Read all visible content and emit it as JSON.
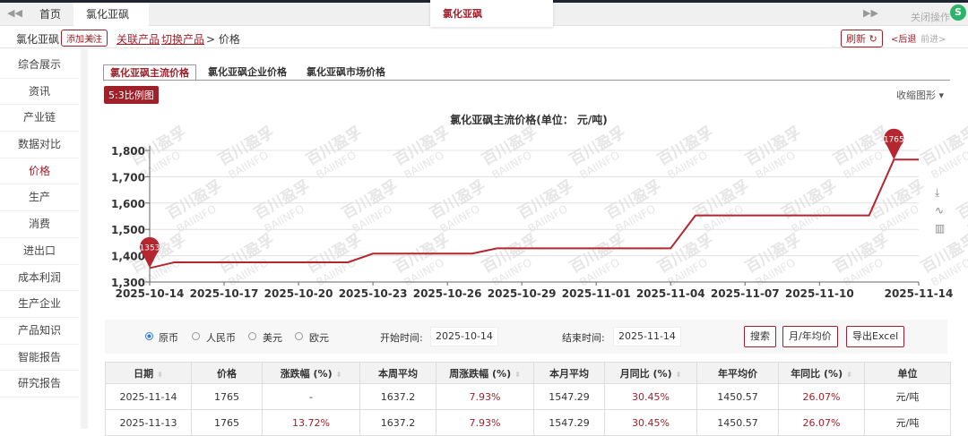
{
  "tabs": {
    "home": "首页",
    "current": "氯化亚砜",
    "popup": "氯化亚砜",
    "close_ops": "关闭操作"
  },
  "breadcrumb": {
    "product": "氯化亚砜",
    "follow": "添加关注",
    "related": "关联产品",
    "switch": "切换产品",
    "current": "> 价格",
    "refresh": "刷新 ↻",
    "back": "<后退",
    "forward": "前进>"
  },
  "sidebar": {
    "items": [
      "综合展示",
      "资讯",
      "产业链",
      "数据对比",
      "价格",
      "生产",
      "消费",
      "进出口",
      "成本利润",
      "生产企业",
      "产品知识",
      "智能报告",
      "研究报告"
    ],
    "active": 4
  },
  "content_tabs": [
    "氯化亚砜主流价格",
    "氯化亚砜企业价格",
    "氯化亚砜市场价格"
  ],
  "ratio_label": "5:3比例图",
  "collapse_label": "收缩图形 ▾",
  "chart_data": {
    "type": "line",
    "title": "氯化亚砜主流价格(单位： 元/吨)",
    "x": [
      "2025-10-14",
      "2025-10-15",
      "2025-10-16",
      "2025-10-17",
      "2025-10-18",
      "2025-10-19",
      "2025-10-20",
      "2025-10-21",
      "2025-10-22",
      "2025-10-23",
      "2025-10-24",
      "2025-10-25",
      "2025-10-26",
      "2025-10-27",
      "2025-10-28",
      "2025-10-29",
      "2025-10-30",
      "2025-10-31",
      "2025-11-01",
      "2025-11-02",
      "2025-11-03",
      "2025-11-04",
      "2025-11-05",
      "2025-11-06",
      "2025-11-07",
      "2025-11-08",
      "2025-11-09",
      "2025-11-10",
      "2025-11-11",
      "2025-11-12",
      "2025-11-13",
      "2025-11-14"
    ],
    "values": [
      1353,
      1375,
      1375,
      1375,
      1375,
      1375,
      1375,
      1375,
      1375,
      1408,
      1408,
      1408,
      1408,
      1408,
      1428,
      1428,
      1428,
      1428,
      1428,
      1428,
      1428,
      1428,
      1553,
      1553,
      1553,
      1553,
      1553,
      1553,
      1553,
      1553,
      1765,
      1765
    ],
    "xticks": [
      "2025-10-14",
      "2025-10-17",
      "2025-10-20",
      "2025-10-23",
      "2025-10-26",
      "2025-10-29",
      "2025-11-01",
      "2025-11-04",
      "2025-11-07",
      "2025-11-10",
      "2025-11-14"
    ],
    "yticks": [
      "1,300",
      "1,400",
      "1,500",
      "1,600",
      "1,700",
      "1,800"
    ],
    "ylim": [
      1300,
      1800
    ],
    "markers": [
      {
        "label": "1353",
        "index": 0
      },
      {
        "label": "1765",
        "index": 30
      }
    ],
    "color": "#b5262e",
    "watermark": "百川盈孚 BAIINFO"
  },
  "controls": {
    "currencies": [
      "原币",
      "人民币",
      "美元",
      "欧元"
    ],
    "selected": 0,
    "start_label": "开始时间:",
    "start": "2025-10-14",
    "end_label": "结束时间:",
    "end": "2025-11-14",
    "search": "搜索",
    "avg": "月/年均价",
    "export": "导出Excel"
  },
  "table": {
    "headers": [
      "日期",
      "价格",
      "涨跌幅 (%)",
      "本周平均",
      "周涨跌幅 (%)",
      "本月平均",
      "月同比 (%)",
      "年平均价",
      "年同比 (%)",
      "单位"
    ],
    "rows": [
      [
        "2025-11-14",
        "1765",
        "-",
        "1637.2",
        "7.93%",
        "1547.29",
        "30.45%",
        "1450.57",
        "26.07%",
        "元/吨"
      ],
      [
        "2025-11-13",
        "1765",
        "13.72%",
        "1637.2",
        "7.93%",
        "1547.29",
        "30.45%",
        "1450.57",
        "26.07%",
        "元/吨"
      ]
    ]
  }
}
